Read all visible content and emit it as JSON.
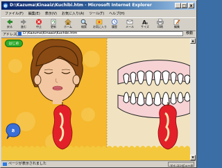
{
  "window": {
    "title": "D:\\Kazuma\\Kinaaiz\\Kuchibi.htm - Microsoft Internet Explorer",
    "controls": [
      "_",
      "□",
      "x"
    ]
  },
  "menu": [
    "ファイル(F)",
    "編集(E)",
    "表示(V)",
    "お気に入り(A)",
    "ツール(T)",
    "ヘルプ(H)"
  ],
  "toolbar": [
    {
      "label": "戻る",
      "icon": "back-arrow-icon"
    },
    {
      "label": "進む",
      "icon": "forward-arrow-icon"
    },
    {
      "label": "中止",
      "icon": "stop-icon"
    },
    {
      "label": "更新",
      "icon": "refresh-icon"
    },
    {
      "label": "ホーム",
      "icon": "home-icon"
    },
    {
      "label": "検索",
      "icon": "search-icon"
    },
    {
      "label": "お気に入り",
      "icon": "favorites-icon"
    },
    {
      "label": "履歴",
      "icon": "history-icon"
    },
    {
      "label": "メール",
      "icon": "mail-icon"
    },
    {
      "label": "サイズ",
      "icon": "font-size-icon"
    },
    {
      "label": "印刷",
      "icon": "print-icon"
    },
    {
      "label": "編集",
      "icon": "edit-icon"
    }
  ],
  "address": {
    "label": "アドレス(D)",
    "url": "D:\\Kazuma\\Kinaaiz\\Kuchibi.htm",
    "go": "移動"
  },
  "content": {
    "start_button": "はじめ",
    "bubble_text": "あ"
  },
  "status": {
    "text": "ページが表示されました",
    "zone": "マイ コンピュータ"
  },
  "colors": {
    "title_start": "#0a246a",
    "panel_left": "#f5b82e",
    "panel_right": "#f1e3c2",
    "apple_red": "#e3202a",
    "hair": "#8a4a14",
    "skin": "#f3c7a2",
    "start_button": "#2faa2b",
    "bubble": "#3a6fd6"
  }
}
